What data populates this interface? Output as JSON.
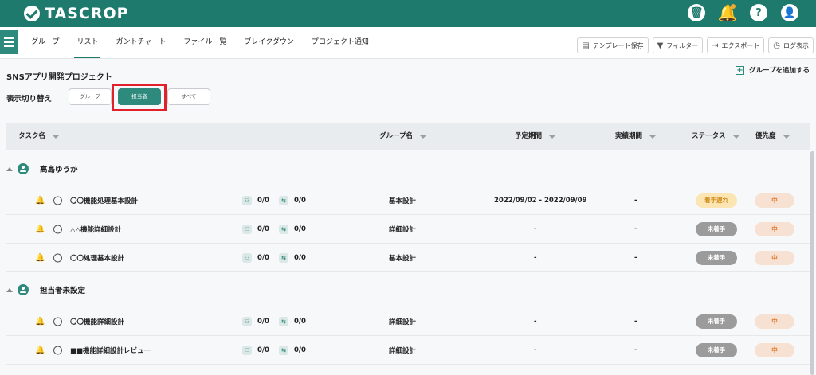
{
  "app": {
    "logo": "TASCROP"
  },
  "top_icons": [
    "trash-icon",
    "bell-icon",
    "help-icon",
    "user-icon"
  ],
  "tabs": [
    {
      "label": "グループ",
      "active": false
    },
    {
      "label": "リスト",
      "active": true
    },
    {
      "label": "ガントチャート",
      "active": false
    },
    {
      "label": "ファイル一覧",
      "active": false
    },
    {
      "label": "ブレイクダウン",
      "active": false
    },
    {
      "label": "プロジェクト通知",
      "active": false
    }
  ],
  "toolbar": {
    "template": "テンプレート保存",
    "filter": "フィルター",
    "export": "エクスポート",
    "log": "ログ表示"
  },
  "project": {
    "title": "SNSアプリ開発プロジェクト",
    "add_group": "グループを追加する"
  },
  "view_switch": {
    "label": "表示切り替え",
    "options": [
      "グループ",
      "担当者",
      "すべて"
    ],
    "selected": "担当者"
  },
  "table": {
    "headers": {
      "task": "タスク名",
      "group": "グループ名",
      "planned": "予定期間",
      "actual": "実績期間",
      "status": "ステータス",
      "priority": "優先度"
    }
  },
  "groups": [
    {
      "name": "高島ゆうか",
      "tasks": [
        {
          "name": "〇〇機能処理基本設計",
          "sub": "0/0",
          "link": "0/0",
          "group": "基本設計",
          "planned": "2022/09/02 - 2022/09/09",
          "actual": "-",
          "status": "着手遅れ",
          "priority": "中"
        },
        {
          "name": "△△機能詳細設計",
          "sub": "0/0",
          "link": "0/0",
          "group": "詳細設計",
          "planned": "-",
          "actual": "-",
          "status": "未着手",
          "priority": "中"
        },
        {
          "name": "〇〇処理基本設計",
          "sub": "0/0",
          "link": "0/0",
          "group": "基本設計",
          "planned": "-",
          "actual": "-",
          "status": "未着手",
          "priority": "中"
        }
      ]
    },
    {
      "name": "担当者未設定",
      "tasks": [
        {
          "name": "〇〇機能詳細設計",
          "sub": "0/0",
          "link": "0/0",
          "group": "詳細設計",
          "planned": "-",
          "actual": "-",
          "status": "未着手",
          "priority": "中"
        },
        {
          "name": "■■機能詳細設計レビュー",
          "sub": "0/0",
          "link": "0/0",
          "group": "詳細設計",
          "planned": "-",
          "actual": "-",
          "status": "未着手",
          "priority": "中"
        }
      ]
    }
  ]
}
